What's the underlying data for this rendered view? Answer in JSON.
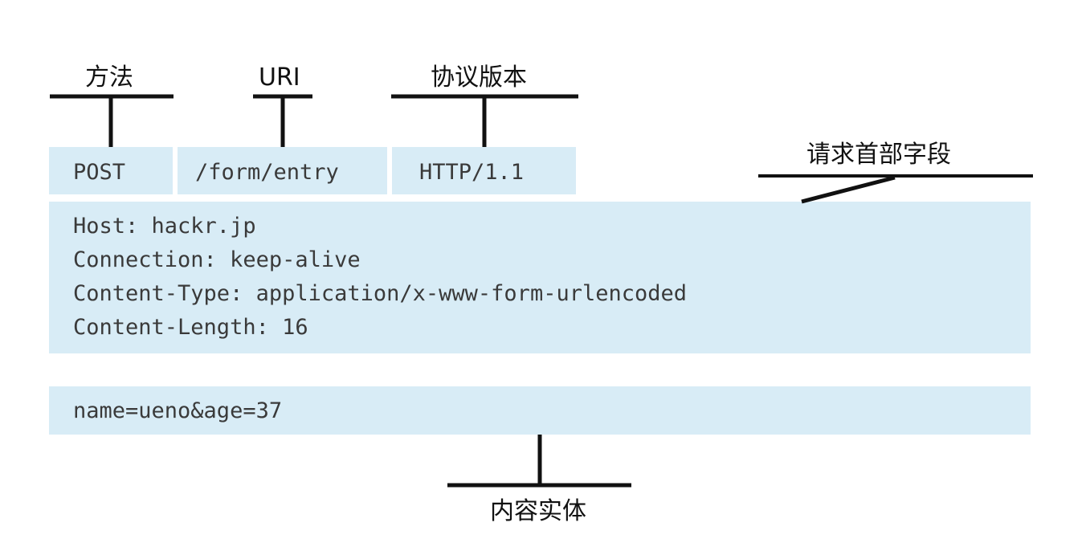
{
  "labels": {
    "method": "方法",
    "uri": "URI",
    "version": "协议版本",
    "headers": "请求首部字段",
    "body": "内容实体"
  },
  "request_line": {
    "method": "POST",
    "uri": "/form/entry",
    "version": "HTTP/1.1"
  },
  "headers": [
    "Host: hackr.jp",
    "Connection: keep-alive",
    "Content-Type: application/x-www-form-urlencoded",
    "Content-Length: 16"
  ],
  "body": "name=ueno&age=37",
  "colors": {
    "box": "#d8ecf6",
    "line": "#111111",
    "code_text": "#3a3a3a"
  }
}
